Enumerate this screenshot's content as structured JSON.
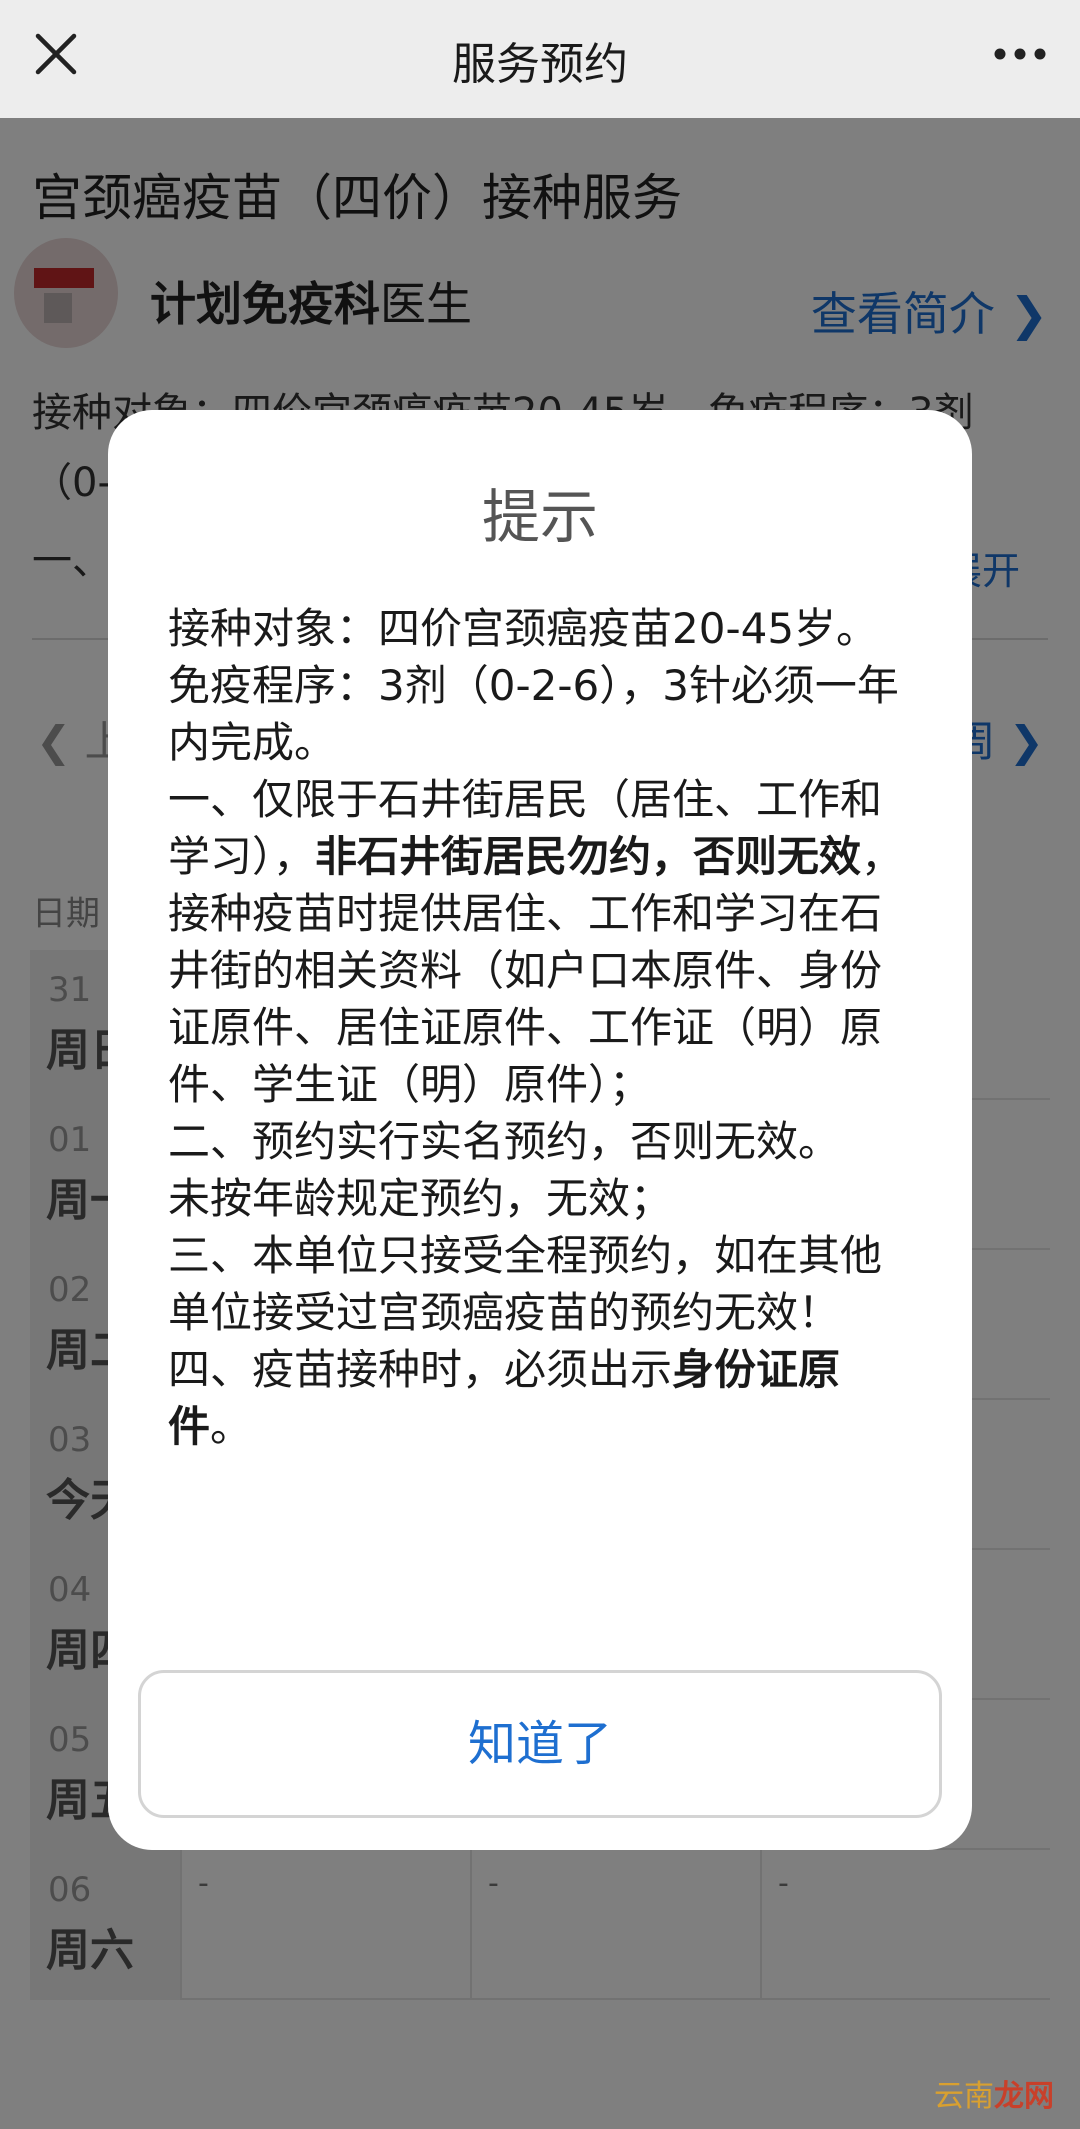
{
  "topbar": {
    "title": "服务预约"
  },
  "service": {
    "title": "宫颈癌疫苗（四价）接种服务",
    "department": "计划免疫科",
    "role": "医生",
    "intro_link": "查看简介",
    "desc_line1": "接种对象：四价宫颈癌疫苗20-45岁，免疫程序：3剂",
    "desc_line2": "（0-",
    "desc_line3": "一、",
    "expand": "展开"
  },
  "week_nav": {
    "prev": "上",
    "next": "周"
  },
  "table": {
    "date_header": "日期",
    "rows": [
      {
        "num": "31",
        "day": "周日",
        "cells": [
          "",
          "",
          ""
        ]
      },
      {
        "num": "01",
        "day": "周一",
        "cells": [
          "",
          "",
          ""
        ]
      },
      {
        "num": "02",
        "day": "周二",
        "cells": [
          "",
          "",
          ""
        ]
      },
      {
        "num": "03",
        "day": "今天",
        "cells": [
          "",
          "",
          ""
        ]
      },
      {
        "num": "04",
        "day": "周四",
        "cells": [
          "",
          "",
          ""
        ]
      },
      {
        "num": "05",
        "day": "周五",
        "cells": [
          "",
          "",
          ""
        ]
      },
      {
        "num": "06",
        "day": "周六",
        "cells": [
          "-",
          "-",
          "-"
        ]
      }
    ]
  },
  "dialog": {
    "title": "提示",
    "p1": "接种对象：四价宫颈癌疫苗20-45岁。",
    "p2": "免疫程序：3剂（0-2-6），3针必须一年内完成。",
    "p3_a": "一、仅限于石井街居民（居住、工作和学习），",
    "p3_bold": "非石井街居民勿约，否则无效",
    "p3_b": "，接种疫苗时提供居住、工作和学习在石井街的相关资料（如户口本原件、身份证原件、居住证原件、工作证（明）原件、学生证（明）原件）；",
    "p4": "二、预约实行实名预约，否则无效。",
    "p5": "未按年龄规定预约，无效；",
    "p6": "三、本单位只接受全程预约，如在其他单位接受过宫颈癌疫苗的预约无效！",
    "p7_a": "四、疫苗接种时，必须出示",
    "p7_bold": "身份证原件",
    "p7_b": "。",
    "ok_label": "知道了"
  },
  "watermark": {
    "part1": "云南",
    "part2": "龙网"
  }
}
